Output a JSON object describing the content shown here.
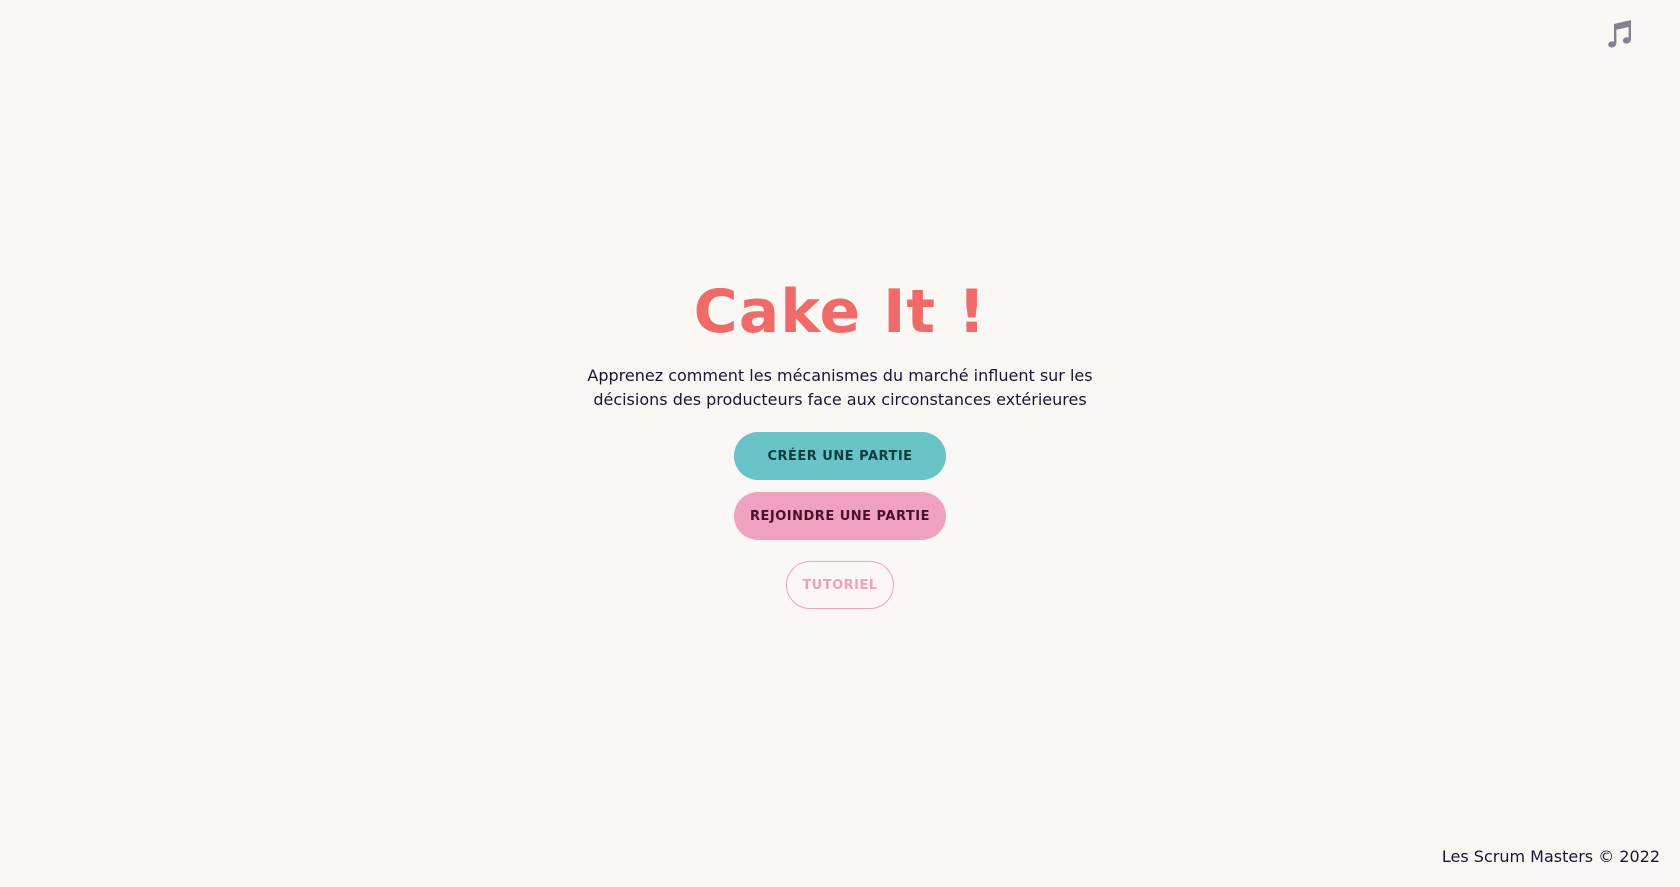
{
  "header": {
    "music_icon": "music-note-icon"
  },
  "hero": {
    "title": "Cake It !",
    "subtitle": "Apprenez comment les mécanismes du marché influent sur les décisions des producteurs face aux circonstances extérieures"
  },
  "actions": {
    "create_label": "CRÉER UNE PARTIE",
    "join_label": "REJOINDRE UNE PARTIE",
    "tutorial_label": "TUTORIEL"
  },
  "footer": {
    "copyright": "Les Scrum Masters © 2022"
  },
  "colors": {
    "background": "#fbf7f4",
    "title": "#f06a6a",
    "create_button": "#68c4c6",
    "join_button": "#f0a1bf",
    "tutorial_outline": "#f0a1bf",
    "text": "#1f1330",
    "icon": "#8a7f92"
  }
}
